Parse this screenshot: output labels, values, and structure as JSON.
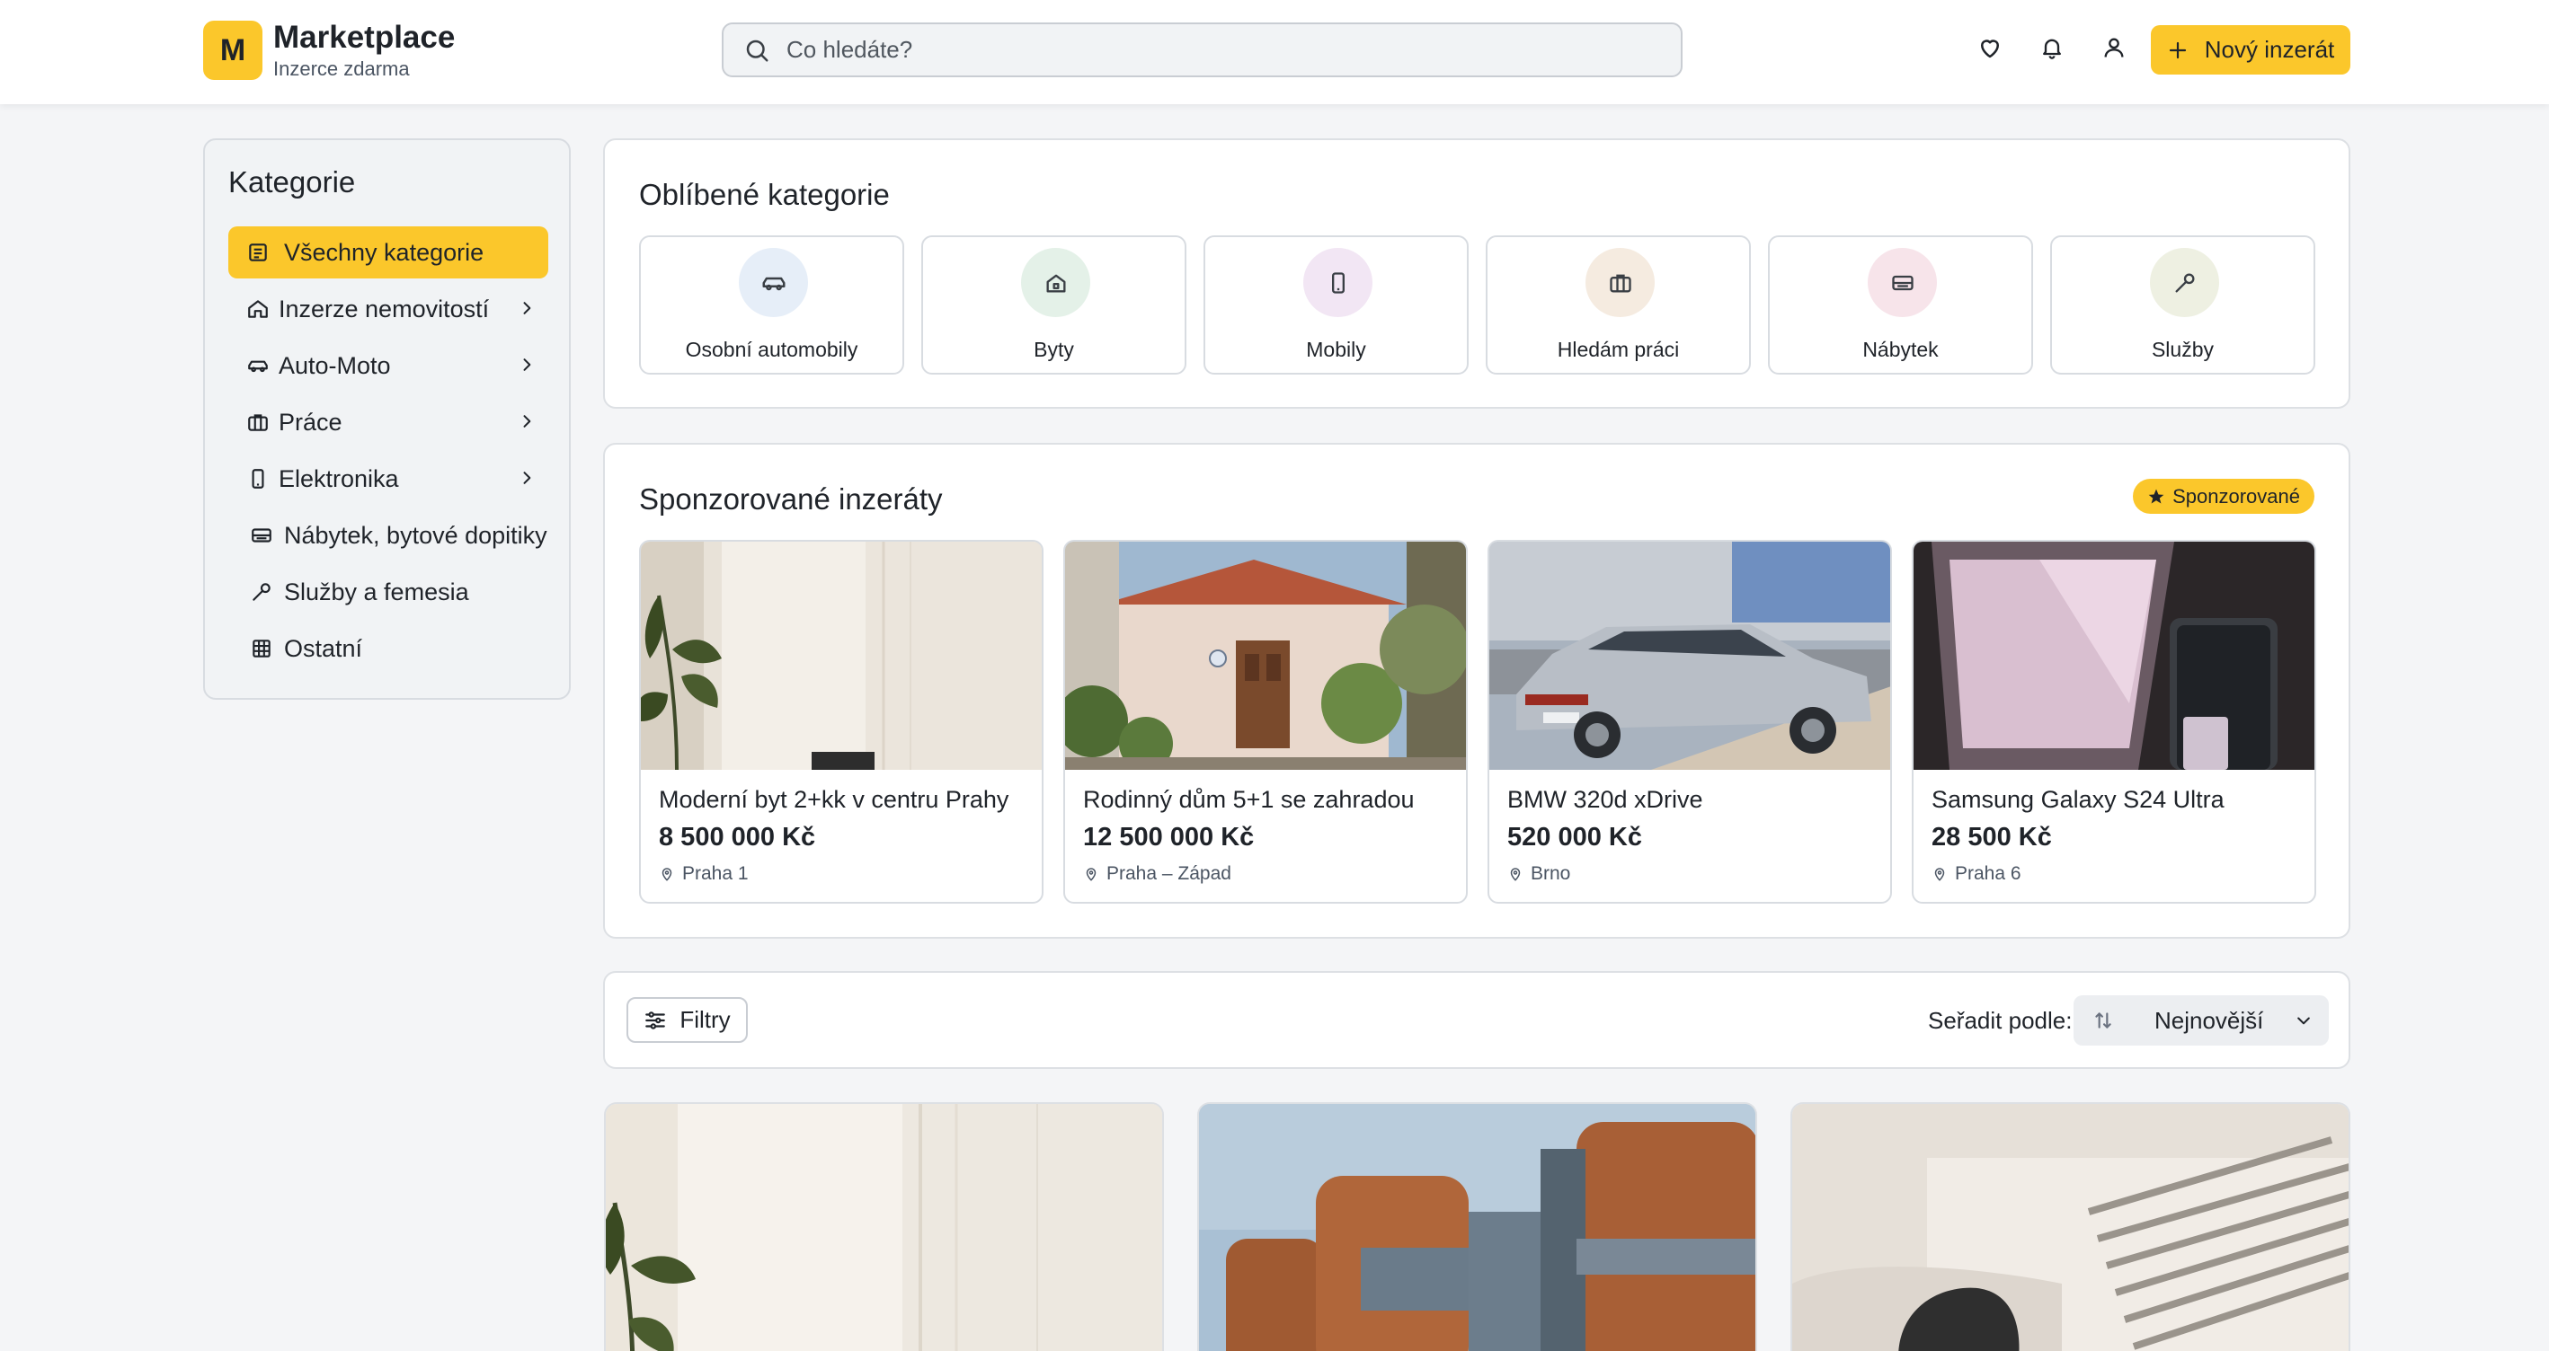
{
  "header": {
    "logo_letter": "M",
    "brand_name": "Marketplace",
    "brand_sub": "Inzerce zdarma",
    "search_placeholder": "Co hledáte?",
    "new_listing_label": "Nový inzerát",
    "accent_color": "#fbc72b"
  },
  "sidebar": {
    "title": "Kategorie",
    "items": [
      {
        "label": "Všechny kategorie",
        "icon": "list-icon",
        "active": true,
        "has_submenu": false
      },
      {
        "label": "Inzerze nemovitostí",
        "icon": "home-icon",
        "active": false,
        "has_submenu": true
      },
      {
        "label": "Auto-Moto",
        "icon": "car-icon",
        "active": false,
        "has_submenu": true
      },
      {
        "label": "Práce",
        "icon": "briefcase-icon",
        "active": false,
        "has_submenu": true
      },
      {
        "label": "Elektronika",
        "icon": "phone-icon",
        "active": false,
        "has_submenu": true
      },
      {
        "label": "Nábytek, bytové dopitiky",
        "icon": "sofa-icon",
        "active": false,
        "has_submenu": false
      },
      {
        "label": "Služby a femesia",
        "icon": "wrench-icon",
        "active": false,
        "has_submenu": false
      },
      {
        "label": "Ostatní",
        "icon": "grid-icon",
        "active": false,
        "has_submenu": false
      }
    ]
  },
  "favorites": {
    "title": "Oblíbené kategorie",
    "items": [
      {
        "label": "Osobní automobily",
        "icon": "car-icon",
        "bg": "#e6eef8"
      },
      {
        "label": "Byty",
        "icon": "home-icon",
        "bg": "#e4f1e8"
      },
      {
        "label": "Mobily",
        "icon": "phone-icon",
        "bg": "#f2e6f4"
      },
      {
        "label": "Hledám práci",
        "icon": "briefcase-icon",
        "bg": "#f5ebe0"
      },
      {
        "label": "Nábytek",
        "icon": "sofa-icon",
        "bg": "#f7e4ea"
      },
      {
        "label": "Služby",
        "icon": "wrench-icon",
        "bg": "#eef0e2"
      }
    ]
  },
  "sponsored": {
    "title": "Sponzorované inzeráty",
    "badge": "Sponzorované",
    "items": [
      {
        "title": "Moderní byt 2+kk v centru Prahy",
        "price": "8 500 000 Kč",
        "location": "Praha 1",
        "image": "apartment-photo"
      },
      {
        "title": "Rodinný dům 5+1 se zahradou",
        "price": "12 500 000 Kč",
        "location": "Praha – Západ",
        "image": "house-photo"
      },
      {
        "title": "BMW 320d xDrive",
        "price": "520 000 Kč",
        "location": "Brno",
        "image": "car-photo"
      },
      {
        "title": "Samsung Galaxy S24 Ultra",
        "price": "28 500 Kč",
        "location": "Praha 6",
        "image": "phone-photo"
      }
    ]
  },
  "toolbar": {
    "filter_label": "Filtry",
    "sort_label": "Seřadit podle:",
    "sort_value": "Nejnovější"
  }
}
